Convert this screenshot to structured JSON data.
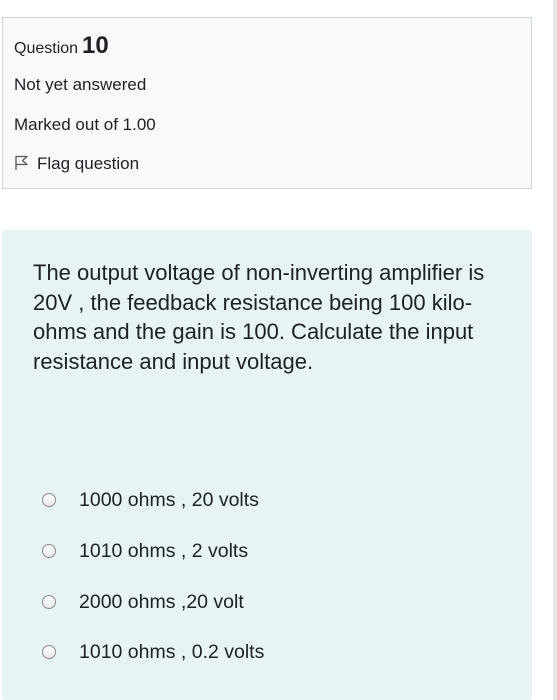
{
  "info": {
    "question_label": "Question",
    "question_number": "10",
    "state": "Not yet answered",
    "grade": "Marked out of 1.00",
    "flag_label": "Flag question"
  },
  "question": {
    "text": "The output voltage of non-inverting amplifier is 20V , the feedback resistance being 100 kilo-ohms and the gain is 100. Calculate the input resistance and input voltage."
  },
  "answers": [
    {
      "label": "1000 ohms , 20 volts"
    },
    {
      "label": "1010 ohms , 2 volts"
    },
    {
      "label": "2000 ohms ,20 volt"
    },
    {
      "label": "1010 ohms , 0.2 volts"
    }
  ],
  "icons": {
    "flag": "flag-outline-icon",
    "radio": "radio-unchecked"
  },
  "colors": {
    "info_bg": "#f8f9fa",
    "formulation_bg": "#e7f3f5",
    "border": "#ced4da"
  }
}
